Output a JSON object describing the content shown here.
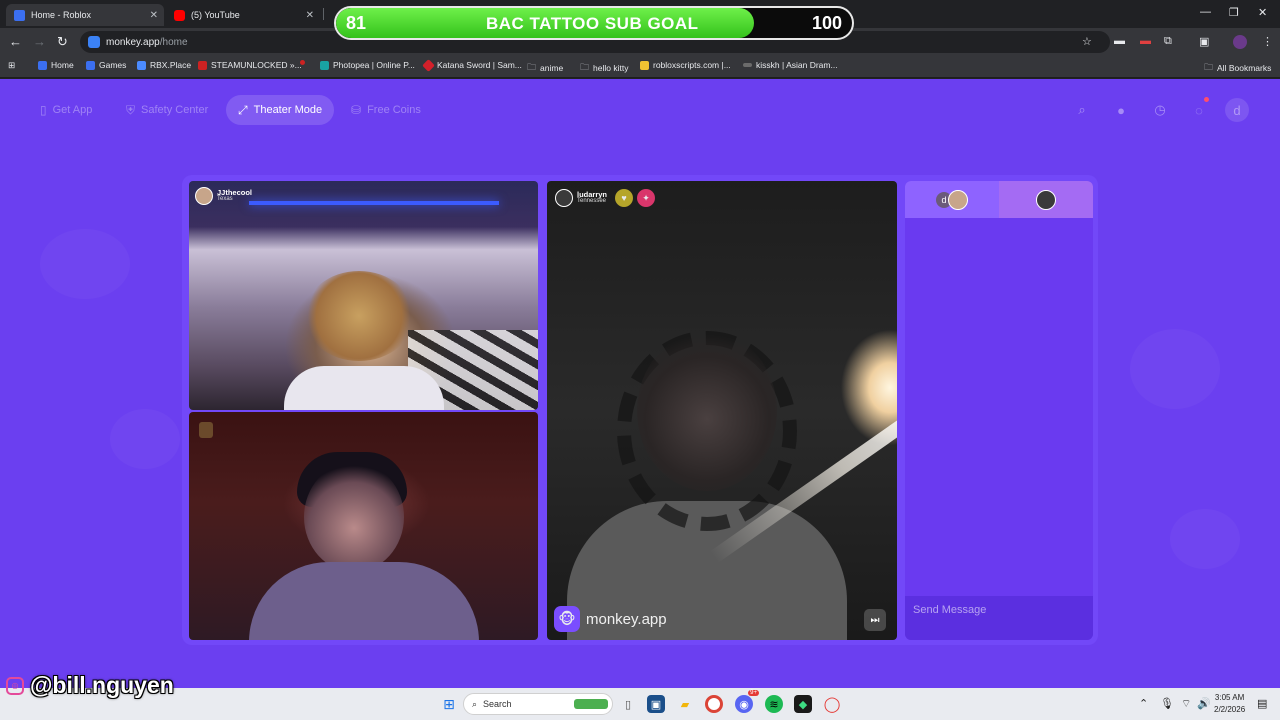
{
  "browser": {
    "tabs": [
      {
        "title": "Home - Roblox",
        "color": "#3b6ff0"
      },
      {
        "title": "(5) YouTube",
        "color": "#ff0000"
      }
    ],
    "url_host": "monkey.app",
    "url_path": "/home",
    "bookmarks": [
      {
        "label": "Home",
        "color": "#3b6ff0"
      },
      {
        "label": "Games",
        "color": "#3b6ff0"
      },
      {
        "label": "RBX.Place",
        "color": "#4b8bff"
      },
      {
        "label": "STEAMUNLOCKED »...",
        "color": "#cc2222"
      },
      {
        "label": "",
        "color": "#cc2222"
      },
      {
        "label": "Photopea | Online P...",
        "color": "#19a3a3"
      },
      {
        "label": "Katana Sword | Sam...",
        "color": "#d3202a"
      },
      {
        "label": "anime",
        "color": "#9aa0a6"
      },
      {
        "label": "hello kitty",
        "color": "#9aa0a6"
      },
      {
        "label": "robloxscripts.com |...",
        "color": "#f1c232"
      },
      {
        "label": "kisskh | Asian Dram...",
        "color": "#6b6b6b"
      }
    ],
    "all_bookmarks": "All Bookmarks"
  },
  "goal": {
    "current": "81",
    "title": "BAC TATTOO SUB GOAL",
    "target": "100",
    "progress": 0.81
  },
  "site": {
    "nav": [
      {
        "label": "Get App",
        "icon": "phone-icon"
      },
      {
        "label": "Safety Center",
        "icon": "shield-icon"
      },
      {
        "label": "Theater Mode",
        "icon": "expand-icon"
      },
      {
        "label": "Free Coins",
        "icon": "coins-icon"
      }
    ],
    "profile_initial": "d",
    "chat_badge_color": "#ff4d6d"
  },
  "videos": {
    "top_left": {
      "name": "JJthecool",
      "location": "Texas"
    },
    "right": {
      "name": "ludarryn",
      "location": "Tennessee"
    }
  },
  "brand": {
    "name": "monkey.app"
  },
  "chat": {
    "tab_initial": "d",
    "placeholder": "Send Message"
  },
  "watermark": {
    "handle": "@bill.nguyen"
  },
  "taskbar": {
    "search": "Search",
    "time": "3:05 AM",
    "date": "2/2/2026",
    "discord_badge": "9+"
  }
}
